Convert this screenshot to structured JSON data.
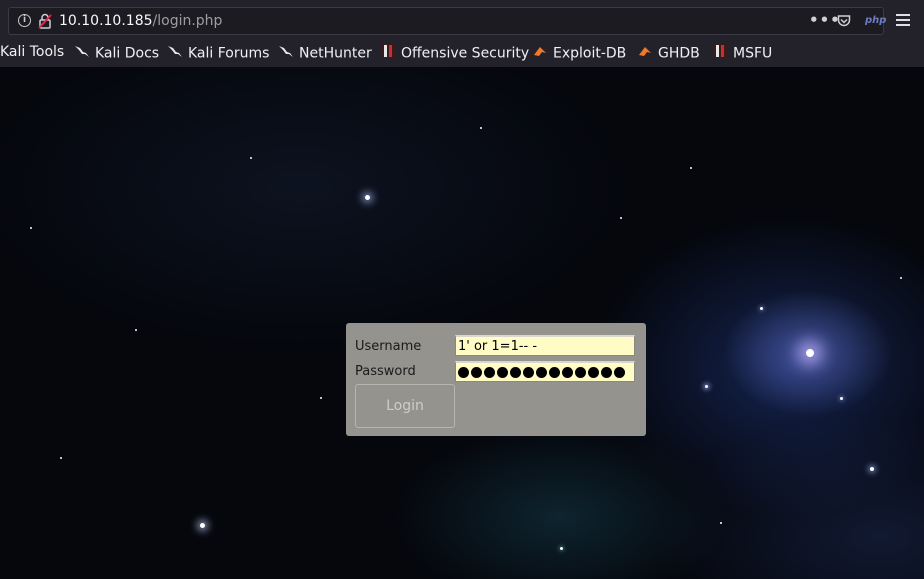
{
  "browser": {
    "url_host": "10.10.10.185",
    "url_path": "/login.php",
    "php_badge": "php",
    "menu_dots": "•••"
  },
  "bookmarks": [
    {
      "label": "Kali Tools",
      "icon": "none"
    },
    {
      "label": "Kali Docs",
      "icon": "kali-dragon-icon"
    },
    {
      "label": "Kali Forums",
      "icon": "kali-dragon-icon"
    },
    {
      "label": "NetHunter",
      "icon": "kali-dragon-icon"
    },
    {
      "label": "Offensive Security",
      "icon": "offsec-icon"
    },
    {
      "label": "Exploit-DB",
      "icon": "exploitdb-icon"
    },
    {
      "label": "GHDB",
      "icon": "exploitdb-icon"
    },
    {
      "label": "MSFU",
      "icon": "offsec-icon"
    }
  ],
  "login": {
    "username_label": "Username",
    "password_label": "Password",
    "username_value": "1' or 1=1-- -",
    "password_masked_length": 13,
    "login_button": "Login"
  },
  "colors": {
    "panel_bg": "#95938e",
    "input_bg": "#fffcc6",
    "chrome_bg": "#23222b"
  }
}
